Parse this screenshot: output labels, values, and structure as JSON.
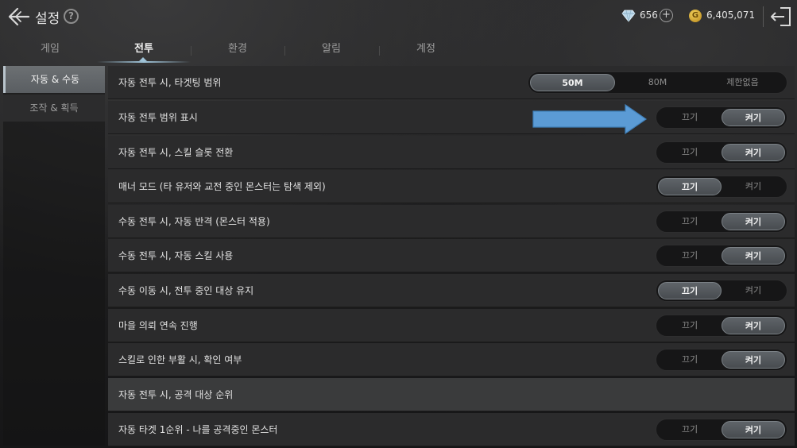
{
  "header": {
    "title": "설정",
    "help_icon": "?",
    "gems": "656",
    "gold": "6,405,071",
    "gold_icon_letter": "G"
  },
  "tabs": [
    {
      "label": "게임",
      "active": false
    },
    {
      "label": "전투",
      "active": true
    },
    {
      "label": "환경",
      "active": false
    },
    {
      "label": "알림",
      "active": false
    },
    {
      "label": "계정",
      "active": false
    }
  ],
  "sidebar": {
    "items": [
      {
        "label": "자동 & 수동",
        "active": true
      },
      {
        "label": "조작 & 획득",
        "active": false
      }
    ]
  },
  "settings": {
    "targeting_range": {
      "label": "자동 전투 시, 타겟팅 범위",
      "options": [
        "50M",
        "80M",
        "제한없음"
      ],
      "selected": "50M"
    },
    "rows": [
      {
        "label": "자동 전투 범위 표시",
        "off": "끄기",
        "on": "켜기",
        "value": "on"
      },
      {
        "label": "자동 전투 시, 스킬 슬롯 전환",
        "off": "끄기",
        "on": "켜기",
        "value": "on"
      },
      {
        "label": "매너 모드 (타 유저와 교전 중인 몬스터는 탐색 제외)",
        "off": "끄기",
        "on": "켜기",
        "value": "off"
      },
      {
        "label": "수동 전투 시, 자동 반격 (몬스터 적용)",
        "off": "끄기",
        "on": "켜기",
        "value": "on"
      },
      {
        "label": "수동 전투 시, 자동 스킬 사용",
        "off": "끄기",
        "on": "켜기",
        "value": "on"
      },
      {
        "label": "수동 이동 시, 전투 중인 대상 유지",
        "off": "끄기",
        "on": "켜기",
        "value": "off"
      },
      {
        "label": "마을 의뢰 연속 진행",
        "off": "끄기",
        "on": "켜기",
        "value": "on"
      },
      {
        "label": "스킬로 인한 부활 시, 확인 여부",
        "off": "끄기",
        "on": "켜기",
        "value": "on"
      }
    ],
    "section_title": "자동 전투 시, 공격 대상 순위",
    "priority_row": {
      "label": "자동 타겟 1순위 - 나를 공격중인 몬스터",
      "off": "끄기",
      "on": "켜기",
      "value": "on"
    }
  },
  "colors": {
    "annotation_arrow": "#5b9bd5",
    "accent": "#9fc3d8"
  },
  "icons": {
    "back": "back-arrow-icon",
    "gem": "diamond-icon",
    "gold": "gold-coin-icon",
    "exit": "exit-icon"
  }
}
